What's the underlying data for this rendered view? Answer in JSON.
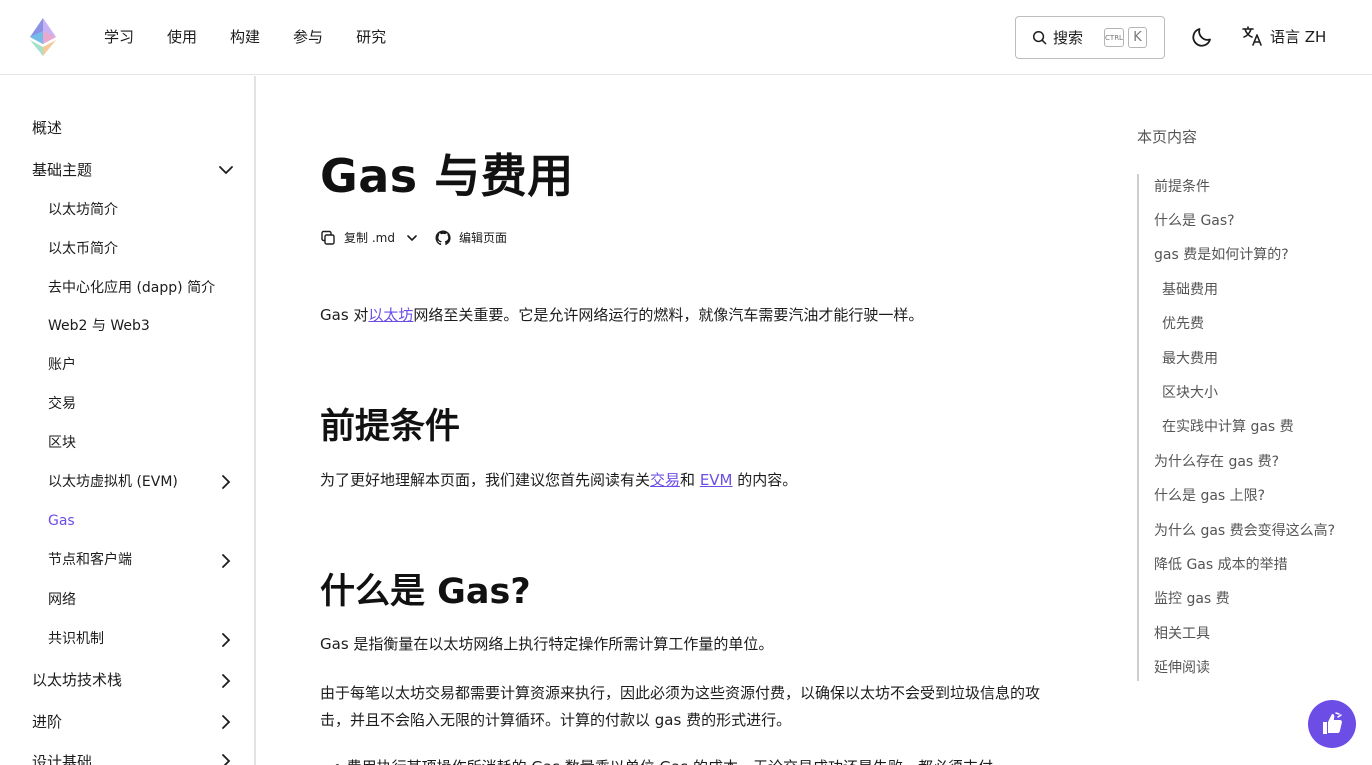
{
  "header": {
    "nav": [
      "学习",
      "使用",
      "构建",
      "参与",
      "研究"
    ],
    "search_label": "搜索",
    "kbd_ctrl": "CTRL",
    "kbd_k": "K",
    "language_label": "语言 ZH"
  },
  "sidebar": {
    "overview": "概述",
    "basics": "基础主题",
    "basics_items": [
      "以太坊简介",
      "以太币简介",
      "去中心化应用 (dapp) 简介",
      "Web2 与 Web3",
      "账户",
      "交易",
      "区块",
      "以太坊虚拟机 (EVM)",
      "Gas",
      "节点和客户端",
      "网络",
      "共识机制"
    ],
    "stack": "以太坊技术栈",
    "advanced": "进阶",
    "design": "设计基础"
  },
  "main": {
    "title": "Gas 与费用",
    "copy_md": "复制 .md",
    "edit_page": "编辑页面",
    "intro_before": "Gas 对",
    "intro_link": "以太坊",
    "intro_after": "网络至关重要。它是允许网络运行的燃料，就像汽车需要汽油才能行驶一样。",
    "h_prereq": "前提条件",
    "prereq_before": "为了更好地理解本页面，我们建议您首先阅读有关",
    "prereq_link1": "交易",
    "prereq_mid": "和 ",
    "prereq_link2": "EVM",
    "prereq_after": " 的内容。",
    "h_what": "什么是 Gas?",
    "what_p1": "Gas 是指衡量在以太坊网络上执行特定操作所需计算工作量的单位。",
    "what_p2": "由于每笔以太坊交易都需要计算资源来执行，因此必须为这些资源付费，以确保以太坊不会受到垃圾信息的攻击，并且不会陷入无限的计算循环。计算的付款以 gas 费的形式进行。",
    "bullet": "• 费用执行某项操作所消耗的 Gas 数量乘以单位 Gas 的成本，无论交易成功还是失败，都必须支付"
  },
  "toc": {
    "title": "本页内容",
    "items": [
      {
        "label": "前提条件",
        "sub": false
      },
      {
        "label": "什么是 Gas?",
        "sub": false
      },
      {
        "label": "gas 费是如何计算的?",
        "sub": false
      },
      {
        "label": "基础费用",
        "sub": true
      },
      {
        "label": "优先费",
        "sub": true
      },
      {
        "label": "最大费用",
        "sub": true
      },
      {
        "label": "区块大小",
        "sub": true
      },
      {
        "label": "在实践中计算 gas 费",
        "sub": true
      },
      {
        "label": "为什么存在 gas 费?",
        "sub": false
      },
      {
        "label": "什么是 gas 上限?",
        "sub": false
      },
      {
        "label": "为什么 gas 费会变得这么高?",
        "sub": false
      },
      {
        "label": "降低 Gas 成本的举措",
        "sub": false
      },
      {
        "label": "监控 gas 费",
        "sub": false
      },
      {
        "label": "相关工具",
        "sub": false
      },
      {
        "label": "延伸阅读",
        "sub": false
      }
    ]
  },
  "colors": {
    "accent": "#6c4de6",
    "text": "#1c1c1c",
    "muted": "#555555"
  },
  "icons": [
    "ethereum-logo",
    "search-icon",
    "moon-icon",
    "translate-icon",
    "chevron-down-icon",
    "chevron-right-icon",
    "copy-icon",
    "github-icon",
    "thumbs-feedback-icon"
  ]
}
